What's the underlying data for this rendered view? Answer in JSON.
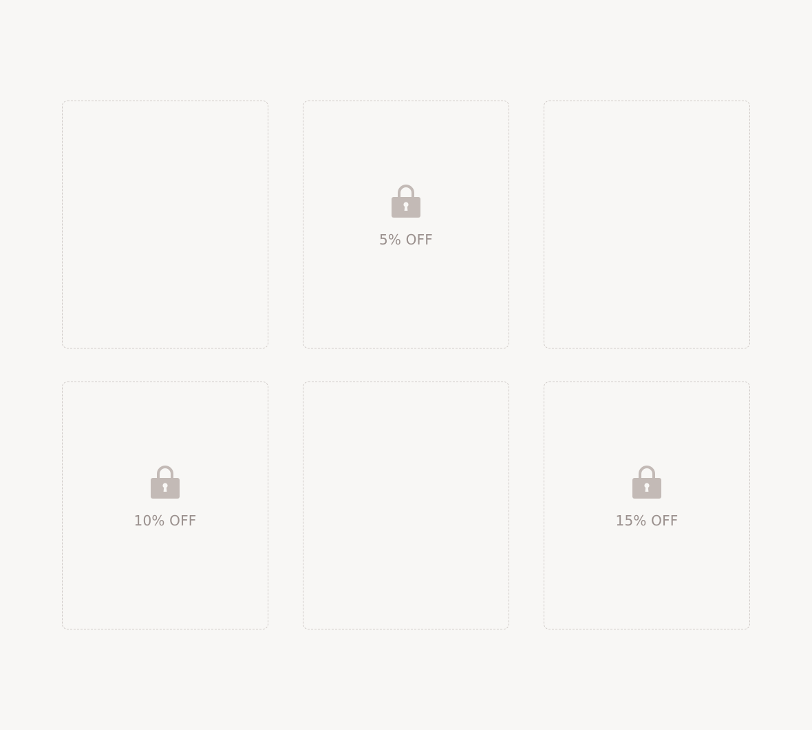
{
  "colors": {
    "background": "#f8f7f5",
    "tile_border": "#cfcac7",
    "lock_icon": "#c3bab6",
    "label_text": "#9a908d"
  },
  "tiles": [
    {
      "locked": false,
      "label": ""
    },
    {
      "locked": true,
      "icon": "lock-icon",
      "label": "5% OFF"
    },
    {
      "locked": false,
      "label": ""
    },
    {
      "locked": true,
      "icon": "lock-icon",
      "label": "10% OFF"
    },
    {
      "locked": false,
      "label": ""
    },
    {
      "locked": true,
      "icon": "lock-icon",
      "label": "15% OFF"
    }
  ]
}
